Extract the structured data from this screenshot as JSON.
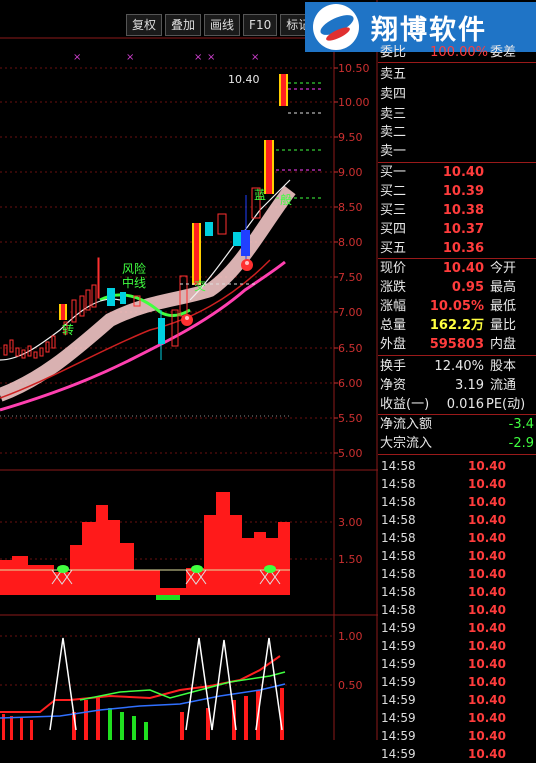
{
  "toolbar": {
    "buttons": [
      "复权",
      "叠加",
      "画线",
      "F10",
      "标记"
    ]
  },
  "logo": {
    "text": "翔博软件"
  },
  "price_axis": [
    "10.50",
    "10.00",
    "9.50",
    "9.00",
    "8.50",
    "8.00",
    "7.50",
    "7.00",
    "6.50",
    "6.00",
    "5.50",
    "5.00"
  ],
  "vol_axis": [
    "3.00",
    "1.50"
  ],
  "ind_axis": [
    "1.00",
    "0.50"
  ],
  "chart_labels": {
    "high_mark": "10.40",
    "risk": "风险",
    "mid": "中线",
    "lan": "蓝",
    "zhuan": "转",
    "jiaohu": "交",
    "yu": "预",
    "qing": "清",
    "ban": "般"
  },
  "ask": {
    "header": "委比",
    "header_val": "100.00%",
    "header2": "委差",
    "rows": [
      {
        "label": "卖五"
      },
      {
        "label": "卖四"
      },
      {
        "label": "卖三"
      },
      {
        "label": "卖二"
      },
      {
        "label": "卖一"
      }
    ]
  },
  "bid": {
    "rows": [
      {
        "label": "买一",
        "val": "10.40"
      },
      {
        "label": "买二",
        "val": "10.39"
      },
      {
        "label": "买三",
        "val": "10.38"
      },
      {
        "label": "买四",
        "val": "10.37"
      },
      {
        "label": "买五",
        "val": "10.36"
      }
    ]
  },
  "quote": [
    {
      "label": "现价",
      "val": "10.40",
      "label2": "今开",
      "color": "#ff3c3c"
    },
    {
      "label": "涨跌",
      "val": "0.95",
      "label2": "最高",
      "color": "#ff3c3c"
    },
    {
      "label": "涨幅",
      "val": "10.05%",
      "label2": "最低",
      "color": "#ff3c3c"
    },
    {
      "label": "总量",
      "val": "162.2万",
      "label2": "量比",
      "color": "#ffff40"
    },
    {
      "label": "外盘",
      "val": "595803",
      "label2": "内盘",
      "color": "#ff3c3c"
    }
  ],
  "fund": [
    {
      "label": "换手",
      "val": "12.40%",
      "label2": "股本",
      "color": "#e8e8e8"
    },
    {
      "label": "净资",
      "val": "3.19",
      "label2": "流通",
      "color": "#e8e8e8"
    },
    {
      "label": "收益(一)",
      "val": "0.016",
      "label2": "PE(动)",
      "color": "#e8e8e8"
    }
  ],
  "flow": [
    {
      "label": "净流入额",
      "val": "-3.4"
    },
    {
      "label": "大宗流入",
      "val": "-2.9"
    }
  ],
  "ticks": [
    {
      "time": "14:58",
      "price": "10.40"
    },
    {
      "time": "14:58",
      "price": "10.40"
    },
    {
      "time": "14:58",
      "price": "10.40"
    },
    {
      "time": "14:58",
      "price": "10.40"
    },
    {
      "time": "14:58",
      "price": "10.40"
    },
    {
      "time": "14:58",
      "price": "10.40"
    },
    {
      "time": "14:58",
      "price": "10.40"
    },
    {
      "time": "14:58",
      "price": "10.40"
    },
    {
      "time": "14:58",
      "price": "10.40"
    },
    {
      "time": "14:59",
      "price": "10.40"
    },
    {
      "time": "14:59",
      "price": "10.40"
    },
    {
      "time": "14:59",
      "price": "10.40"
    },
    {
      "time": "14:59",
      "price": "10.40"
    },
    {
      "time": "14:59",
      "price": "10.40"
    },
    {
      "time": "14:59",
      "price": "10.40"
    },
    {
      "time": "14:59",
      "price": "10.40"
    },
    {
      "time": "14:59",
      "price": "10.40"
    }
  ],
  "colors": {
    "up": "#ff3030",
    "down": "#00e0e0",
    "accent": "#1f74c6"
  }
}
